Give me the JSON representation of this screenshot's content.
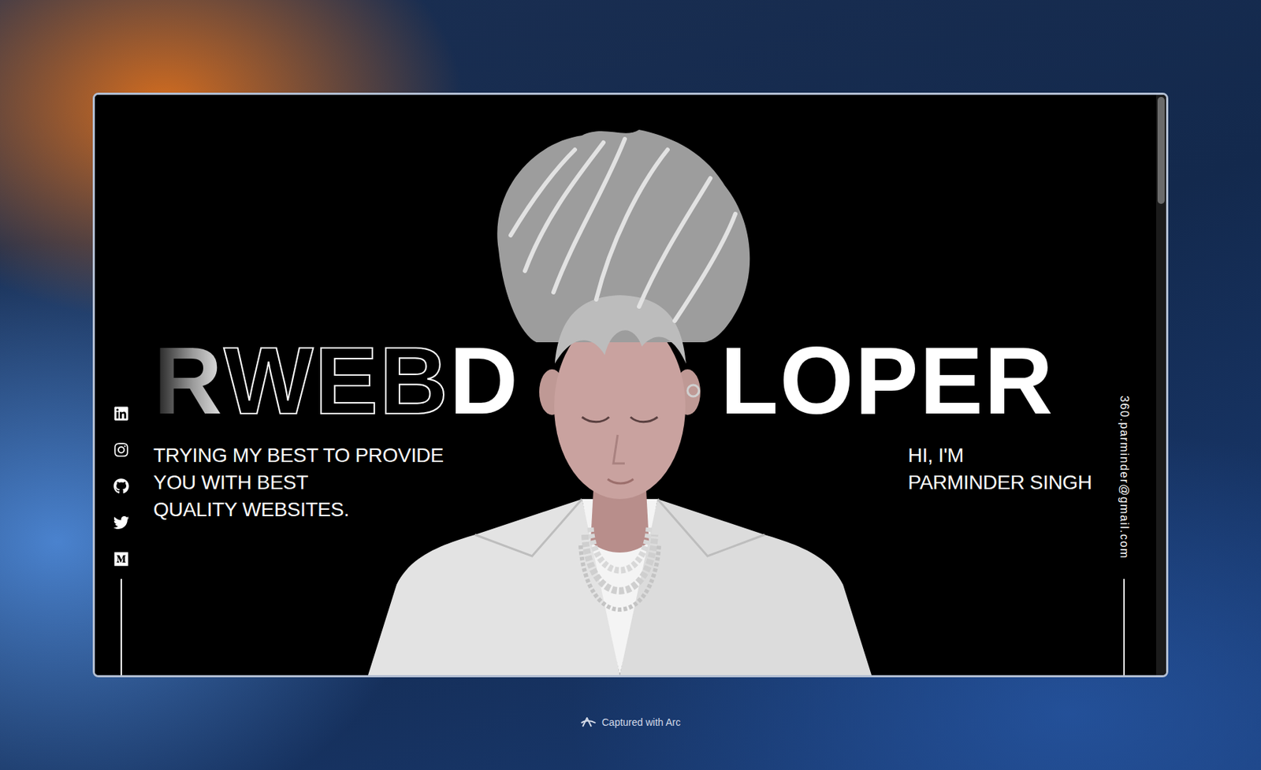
{
  "capture": {
    "caption": "Captured with Arc"
  },
  "headline": {
    "left": [
      {
        "text": "R",
        "kind": "faded"
      },
      {
        "text": "WEB",
        "kind": "outline"
      },
      {
        "text": "D",
        "kind": "solid"
      }
    ],
    "right": [
      {
        "text": "LOPER",
        "kind": "solid"
      }
    ]
  },
  "tagline": [
    "TRYING MY BEST TO PROVIDE",
    "YOU WITH BEST",
    "QUALITY WEBSITES."
  ],
  "intro": [
    "HI, I'M",
    "PARMINDER SINGH"
  ],
  "email": "360.parminder@gmail.com"
}
